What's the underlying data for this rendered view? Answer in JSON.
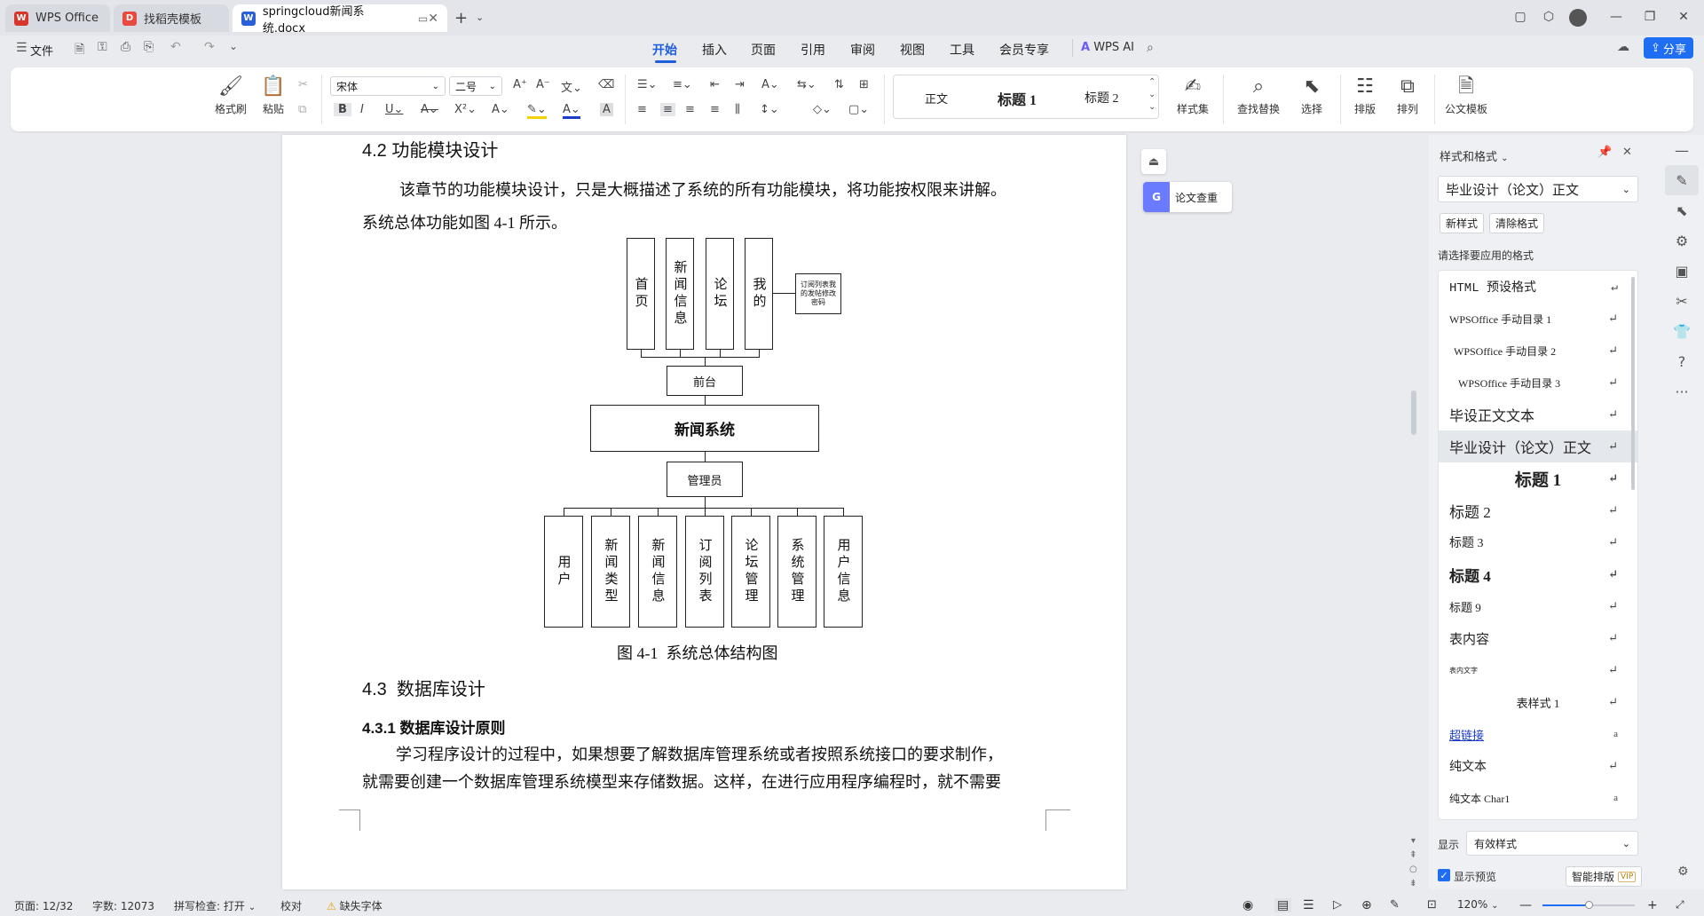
{
  "tabs": [
    {
      "label": "WPS Office",
      "icon": "wps-logo-icon"
    },
    {
      "label": "找稻壳模板",
      "icon": "docer-icon"
    },
    {
      "label": "springcloud新闻系统.docx",
      "icon": "word-doc-icon"
    }
  ],
  "menu": {
    "file_label": "文件",
    "items": [
      "开始",
      "插入",
      "页面",
      "引用",
      "审阅",
      "视图",
      "工具",
      "会员专享"
    ],
    "active": "开始",
    "wps_ai": "WPS AI",
    "share": "分享"
  },
  "ribbon": {
    "format_painter": "格式刷",
    "paste": "粘贴",
    "font_name": "宋体",
    "font_size": "二号",
    "styles": [
      "正文",
      "标题 1",
      "标题 2"
    ],
    "style_set": "样式集",
    "find_replace": "查找替换",
    "select": "选择",
    "layout": "排版",
    "arrange": "排列",
    "doc_template": "公文模板"
  },
  "document": {
    "heading_42": "4.2 功能模块设计",
    "para1_line1": "该章节的功能模块设计，只是大概描述了系统的所有功能模块，将功能按权限来讲解。",
    "para1_line2": "系统总体功能如图 4-1 所示。",
    "figure": {
      "front_modules": [
        "首页",
        "新闻信息",
        "论坛",
        "我的"
      ],
      "mine_sub": "订阅列表我的发帖修改密码",
      "front": "前台",
      "system": "新闻系统",
      "admin": "管理员",
      "admin_modules": [
        "用户",
        "新闻类型",
        "新闻信息",
        "订阅列表",
        "论坛管理",
        "系统管理",
        "用户信息"
      ],
      "caption": "图 4-1  系统总体结构图"
    },
    "heading_43": "4.3  数据库设计",
    "heading_431": "4.3.1 数据库设计原则",
    "para2_line1": "学习程序设计的过程中，如果想要了解数据库管理系统或者按照系统接口的要求制作，",
    "para2_line2": "就需要创建一个数据库管理系统模型来存储数据。这样，在进行应用程序编程时，就不需要"
  },
  "floating": {
    "paper_check": "论文查重"
  },
  "styles_panel": {
    "title": "样式和格式",
    "current_style": "毕业设计（论文）正文",
    "new_style": "新样式",
    "clear_format": "清除格式",
    "prompt": "请选择要应用的格式",
    "items": [
      {
        "label": "HTML 预设格式",
        "mark": "↵"
      },
      {
        "label": "WPSOffice 手动目录 1",
        "mark": "↵"
      },
      {
        "label": "WPSOffice 手动目录 2",
        "mark": "↵"
      },
      {
        "label": "WPSOffice 手动目录 3",
        "mark": "↵"
      },
      {
        "label": "毕设正文文本",
        "mark": "↵"
      },
      {
        "label": "毕业设计（论文）正文",
        "mark": "↵"
      },
      {
        "label": "标题 1",
        "mark": "↵"
      },
      {
        "label": "标题 2",
        "mark": "↵"
      },
      {
        "label": "标题 3",
        "mark": "↵"
      },
      {
        "label": "标题 4",
        "mark": "↵"
      },
      {
        "label": "标题 9",
        "mark": "↵"
      },
      {
        "label": "表内容",
        "mark": "↵"
      },
      {
        "label": "表内文字",
        "mark": "↵"
      },
      {
        "label": "表样式 1",
        "mark": "↵"
      },
      {
        "label": "超链接",
        "mark": "a"
      },
      {
        "label": "纯文本",
        "mark": "↵"
      },
      {
        "label": "纯文本 Char1",
        "mark": "a"
      }
    ],
    "display_label": "显示",
    "display_value": "有效样式",
    "show_preview": "显示预览",
    "smart_layout": "智能排版",
    "vip": "VIP"
  },
  "status": {
    "page": "页面: 12/32",
    "words": "字数: 12073",
    "spell": "拼写检查: 打开",
    "proof": "校对",
    "missing_font": "缺失字体",
    "zoom": "120%"
  },
  "colors": {
    "accent": "#1f5dd9",
    "share_bg": "#1f6df2",
    "wps_red": "#d9362b"
  }
}
